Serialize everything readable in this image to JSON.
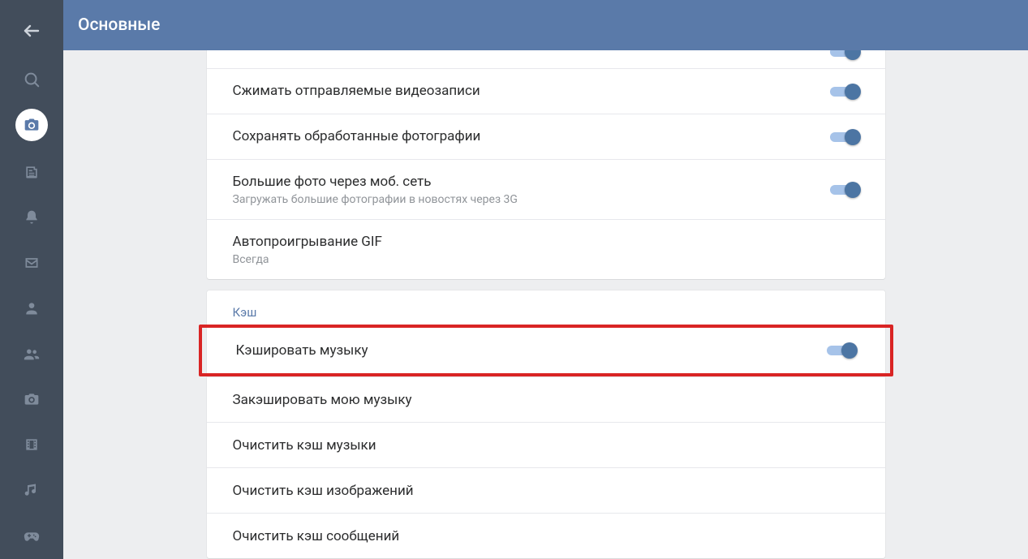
{
  "header": {
    "title": "Основные"
  },
  "group1": {
    "rows": [
      {
        "title": "Сжимать отправляемые видеозаписи",
        "subtitle": "",
        "toggle": true
      },
      {
        "title": "Сохранять обработанные фотографии",
        "subtitle": "",
        "toggle": true
      },
      {
        "title": "Большие фото через моб. сеть",
        "subtitle": "Загружать большие фотографии в новостях через 3G",
        "toggle": true
      },
      {
        "title": "Автопроигрывание GIF",
        "subtitle": "Всегда",
        "toggle": false
      }
    ]
  },
  "group2": {
    "header": "Кэш",
    "rows": [
      {
        "title": "Кэшировать музыку",
        "subtitle": "",
        "toggle": true,
        "highlight": true
      },
      {
        "title": "Закэшировать мою музыку",
        "subtitle": "",
        "toggle": false
      },
      {
        "title": "Очистить кэш музыки",
        "subtitle": "",
        "toggle": false
      },
      {
        "title": "Очистить кэш изображений",
        "subtitle": "",
        "toggle": false
      },
      {
        "title": "Очистить кэш сообщений",
        "subtitle": "",
        "toggle": false
      }
    ]
  }
}
